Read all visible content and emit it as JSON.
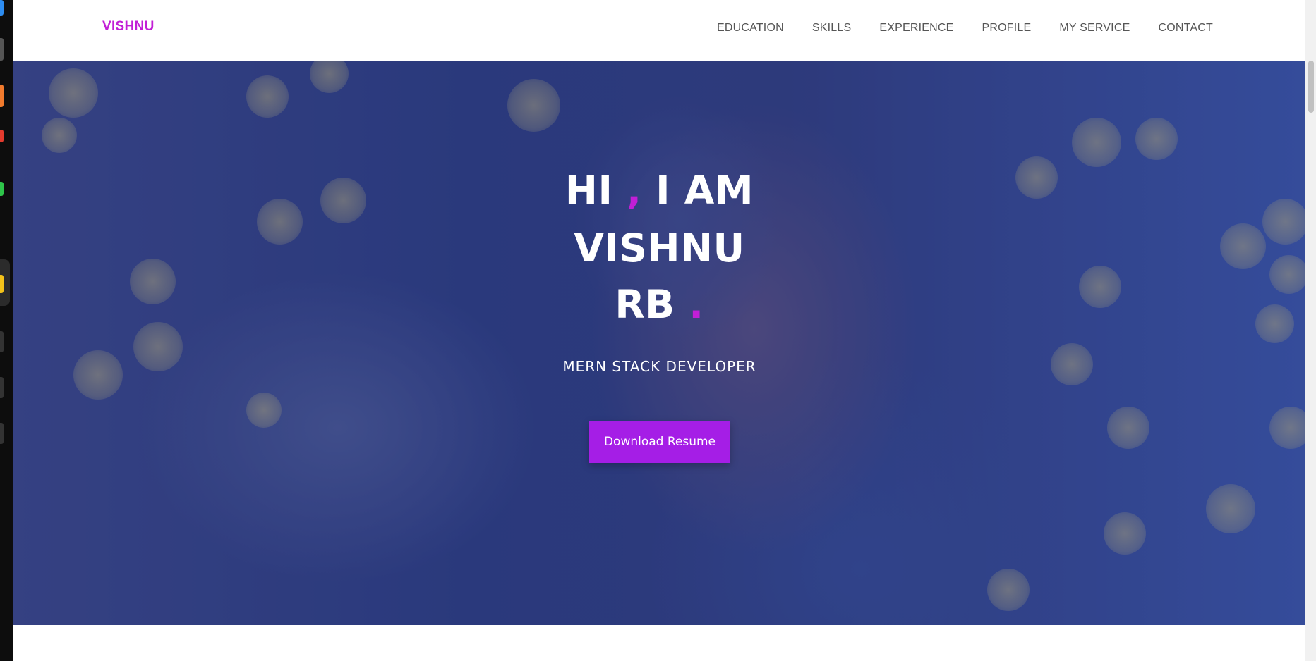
{
  "navbar": {
    "brand": "VISHNU",
    "links": [
      "EDUCATION",
      "SKILLS",
      "EXPERIENCE",
      "PROFILE",
      "MY SERVICE",
      "CONTACT"
    ]
  },
  "hero": {
    "line1_a": "HI",
    "line1_comma": ",",
    "line1_b": "I AM",
    "line2": "VISHNU",
    "line3_a": "RB",
    "line3_dot": ".",
    "subtitle": "MERN STACK DEVELOPER",
    "button_label": "Download Resume"
  },
  "colors": {
    "accent": "#c21fd6",
    "button": "#a51ee6",
    "nav_text": "#555555"
  }
}
